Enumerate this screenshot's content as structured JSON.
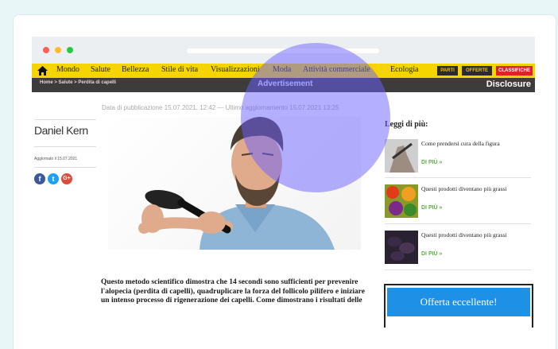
{
  "nav": {
    "home_icon": "home-icon",
    "items": [
      "Mondo",
      "Salute",
      "Bellezza",
      "Stile di vita",
      "Visualizzazioni",
      "Moda",
      "Attività commerciale",
      "Ecologia"
    ],
    "pills": [
      "PARTI",
      "OFFERTE",
      "CLASSIFICHE"
    ],
    "bg_color": "#f5d400"
  },
  "subbar": {
    "breadcrumb": "Home > Salute > Perdita di capelli",
    "advertisement": "Advertisement",
    "disclosure": "Disclosure"
  },
  "article": {
    "dates": "Data di pubblicazione 15.07.2021, 12:42 — Ultimo aggiornamento 15.07.2021 13:25",
    "author": "Daniel Kern",
    "author_date": "Aggiornato il 15.07.2021",
    "social": [
      "facebook-icon",
      "twitter-icon",
      "google-plus-icon"
    ],
    "body": "Questo metodo scientifico dimostra che 14 secondi sono sufficienti per prevenire l'alopecia (perdita di capelli), quadruplicare la forza del follicolo pilifero e iniziare un intenso processo di rigenerazione dei capelli. Come dimostrano i risultati delle"
  },
  "sidebar": {
    "title": "Leggi di più:",
    "items": [
      {
        "text": "Come prendersi cura della figura",
        "more": "DI PIÙ »"
      },
      {
        "text": "Questi prodotti diventano più grassi",
        "more": "DI PIÙ »"
      },
      {
        "text": "Questi prodotti diventano più grassi",
        "more": "DI PIÙ »"
      }
    ],
    "offer_button": "Offerta eccellente!"
  }
}
